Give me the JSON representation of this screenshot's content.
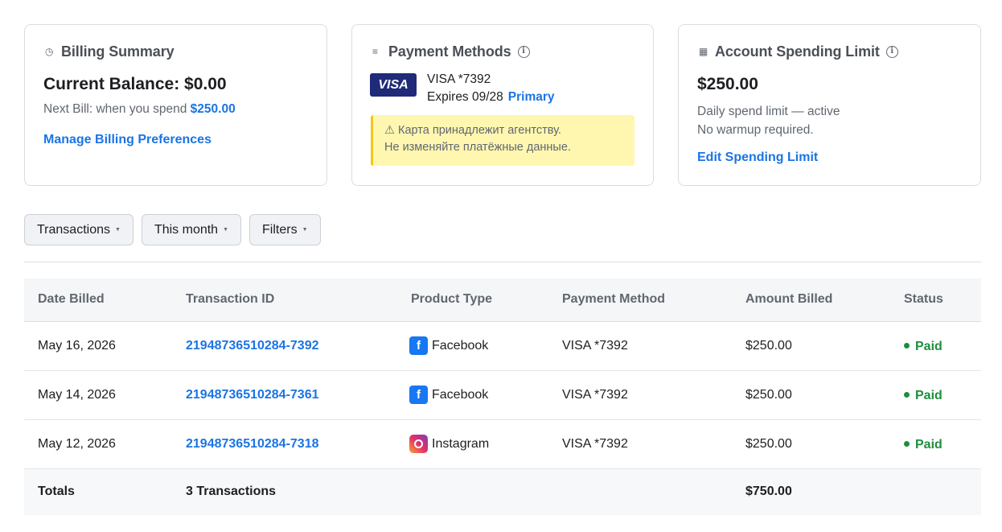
{
  "billing_summary": {
    "icon": "clock-icon",
    "title": "Billing Summary",
    "balance": "Current Balance: $0.00",
    "next_bill_prefix": "Next Bill: when you spend ",
    "next_bill_amount": "$250.00",
    "link": "Manage Billing Preferences"
  },
  "payment_methods": {
    "icon": "list-icon",
    "title": "Payment Methods",
    "badge": "VISA",
    "card": "VISA *7392",
    "expires": "Expires 09/28",
    "primary": "Primary",
    "warning_line1": "⚠ Карта принадлежит агентству.",
    "warning_line2": "Не изменяйте платёжные данные."
  },
  "spending_limit": {
    "icon": "grid-icon",
    "title": "Account Spending Limit",
    "amount": "$250.00",
    "line1": "Daily spend limit — active",
    "line2": "No warmup required.",
    "link": "Edit Spending Limit"
  },
  "filters": [
    {
      "label": "Transactions"
    },
    {
      "label": "This month"
    },
    {
      "label": "Filters"
    }
  ],
  "table": {
    "headers": [
      "Date Billed",
      "Transaction ID",
      "Product Type",
      "Payment Method",
      "Amount Billed",
      "Status"
    ],
    "rows": [
      {
        "date": "May 16, 2026",
        "id": "21948736510284-7392",
        "product": "Facebook",
        "product_icon": "facebook-icon",
        "method": "VISA *7392",
        "amount": "$250.00",
        "status": "Paid"
      },
      {
        "date": "May 14, 2026",
        "id": "21948736510284-7361",
        "product": "Facebook",
        "product_icon": "facebook-icon",
        "method": "VISA *7392",
        "amount": "$250.00",
        "status": "Paid"
      },
      {
        "date": "May 12, 2026",
        "id": "21948736510284-7318",
        "product": "Instagram",
        "product_icon": "instagram-icon",
        "method": "VISA *7392",
        "amount": "$250.00",
        "status": "Paid"
      }
    ],
    "totals": {
      "label": "Totals",
      "count": "3 Transactions",
      "amount": "$750.00"
    }
  },
  "colors": {
    "accent": "#1b74e4",
    "paid": "#1e8e3e",
    "warning_bg": "#fff7b0",
    "visa": "#1f2a78"
  }
}
